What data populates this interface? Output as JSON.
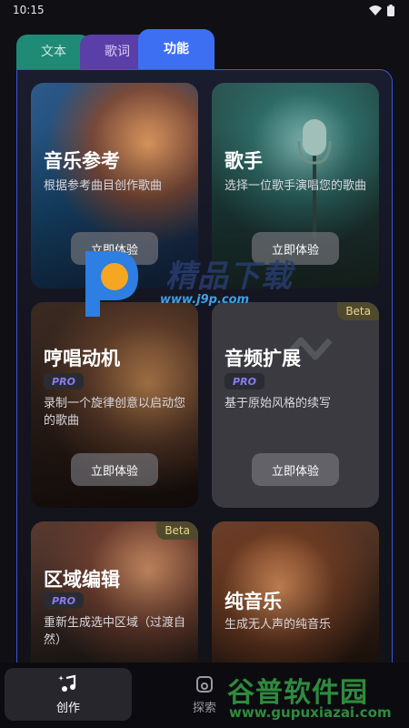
{
  "status": {
    "time": "10:15"
  },
  "tabs": [
    {
      "label": "文本"
    },
    {
      "label": "歌词"
    },
    {
      "label": "功能"
    }
  ],
  "cards": [
    {
      "title": "音乐参考",
      "desc": "根据参考曲目创作歌曲",
      "cta": "立即体验"
    },
    {
      "title": "歌手",
      "desc": "选择一位歌手演唱您的歌曲",
      "cta": "立即体验"
    },
    {
      "title": "哼唱动机",
      "badge": "PRO",
      "desc": "录制一个旋律创意以启动您的歌曲",
      "cta": "立即体验"
    },
    {
      "title": "音频扩展",
      "badge": "PRO",
      "beta": "Beta",
      "desc": "基于原始风格的续写",
      "cta": "立即体验"
    },
    {
      "title": "区域编辑",
      "badge": "PRO",
      "beta": "Beta",
      "desc": "重新生成选中区域（过渡自然）"
    },
    {
      "title": "纯音乐",
      "desc": "生成无人声的纯音乐"
    }
  ],
  "watermark": {
    "text": "精品下载",
    "url": "www.j9p.com"
  },
  "bottom_nav": [
    {
      "label": "创作"
    },
    {
      "label": "探索"
    }
  ],
  "watermark2": {
    "text": "谷普软件园",
    "url": "www.gupuxiazai.com"
  },
  "colors": {
    "accent": "#3d6ff2",
    "tab_text": "#1f8a76",
    "tab_lyrics": "#5b3fa8",
    "pro": "#8a7cf3"
  }
}
